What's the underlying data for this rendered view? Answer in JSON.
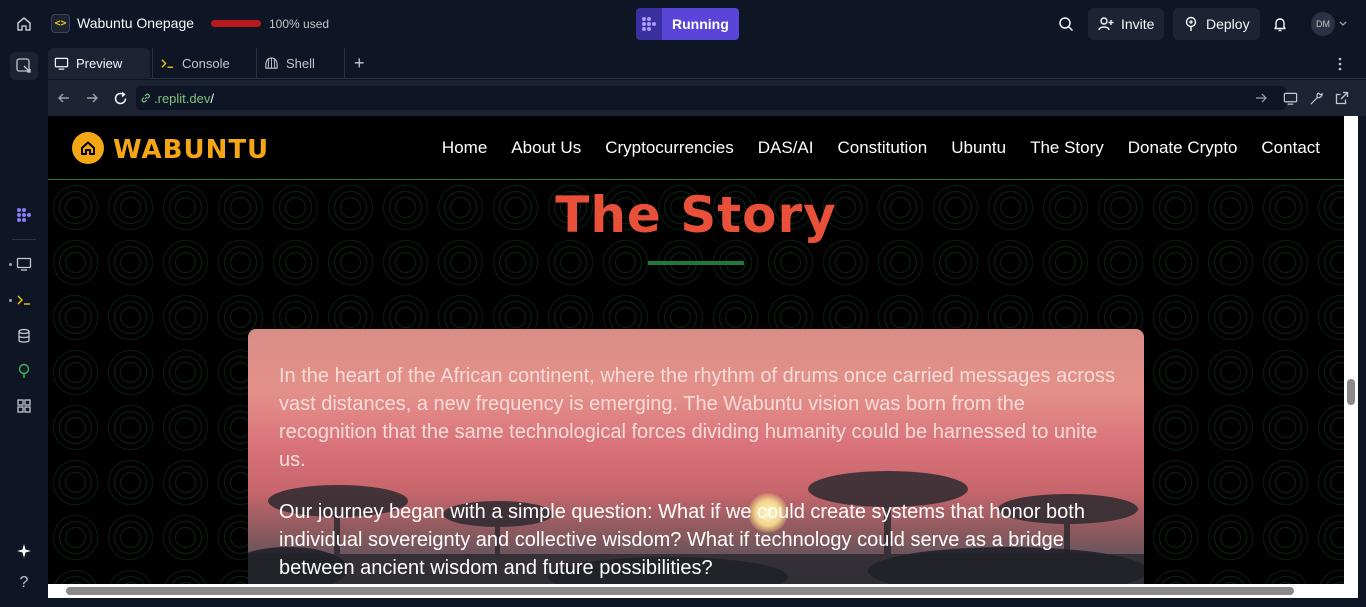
{
  "app": {
    "title": "Wabuntu Onepage",
    "usage_text": "100% used",
    "usage_fraction": 1.0,
    "status": "Running",
    "avatar_initials": "DM"
  },
  "header": {
    "invite_label": "Invite",
    "deploy_label": "Deploy"
  },
  "tabs": [
    {
      "label": "Preview",
      "icon": "monitor-icon"
    },
    {
      "label": "Console",
      "icon": "terminal-icon"
    },
    {
      "label": "Shell",
      "icon": "shell-icon"
    }
  ],
  "url": {
    "domain": ".replit.dev",
    "path": "/"
  },
  "site": {
    "logo_text": "WABUNTU",
    "nav": [
      "Home",
      "About Us",
      "Cryptocurrencies",
      "DAS/AI",
      "Constitution",
      "Ubuntu",
      "The Story",
      "Donate Crypto",
      "Contact"
    ],
    "section_title": "The Story",
    "paragraphs": [
      "In the heart of the African continent, where the rhythm of drums once carried messages across vast distances, a new frequency is emerging. The Wabuntu vision was born from the recognition that the same technological forces dividing humanity could be harnessed to unite us.",
      "Our journey began with a simple question: What if we could create systems that honor both individual sovereignty and collective wisdom? What if technology could serve as a bridge between ancient wisdom and future possibilities?"
    ]
  },
  "colors": {
    "accent": "#5b45d8",
    "brand": "#f5a614",
    "title": "#e8503a",
    "green": "#1f7a3a"
  }
}
